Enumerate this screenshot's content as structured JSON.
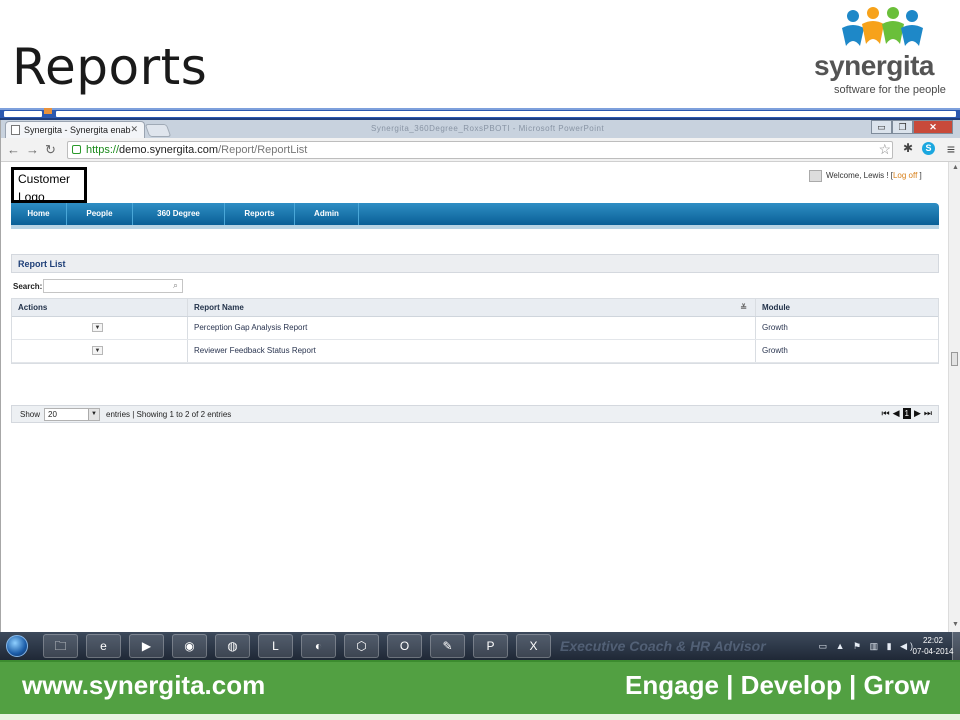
{
  "slide": {
    "title": "Reports",
    "brand": {
      "name": "synergita",
      "tagline": "software for the people",
      "colors": {
        "green": "#52a042",
        "blue": "#1e88c8",
        "orange": "#f7a21a",
        "gray": "#545454"
      }
    }
  },
  "browser": {
    "tab_title": "Synergita - Synergita enab",
    "window_title": "Synergita_360Degree_RoxsPBOTI - Microsoft PowerPoint",
    "url": {
      "scheme": "https://",
      "host": "demo.synergita.com",
      "path": "/Report/ReportList"
    }
  },
  "app": {
    "customer_logo": "Customer Logo",
    "welcome": {
      "text": "Welcome, Lewis ! [",
      "logoff": "Log off",
      "close": " ]"
    },
    "nav": [
      "Home",
      "People",
      "360 Degree",
      "Reports",
      "Admin"
    ],
    "panel_title": "Report List",
    "search": {
      "label": "Search:",
      "value": ""
    },
    "table": {
      "columns": [
        "Actions",
        "Report Name",
        "Module"
      ],
      "rows": [
        {
          "report_name": "Perception Gap Analysis Report",
          "module": "Growth"
        },
        {
          "report_name": "Reviewer Feedback Status Report",
          "module": "Growth"
        }
      ]
    },
    "pager": {
      "show_label": "Show",
      "page_size": "20",
      "info": "entries | Showing 1 to 2 of 2 entries",
      "current_page": "1"
    }
  },
  "taskbar": {
    "ghost_text": "Executive Coach & HR Advisor",
    "clock_time": "22:02",
    "clock_date": "07-04-2014"
  },
  "footer": {
    "url": "www.synergita.com",
    "tagline": "Engage | Develop | Grow"
  }
}
